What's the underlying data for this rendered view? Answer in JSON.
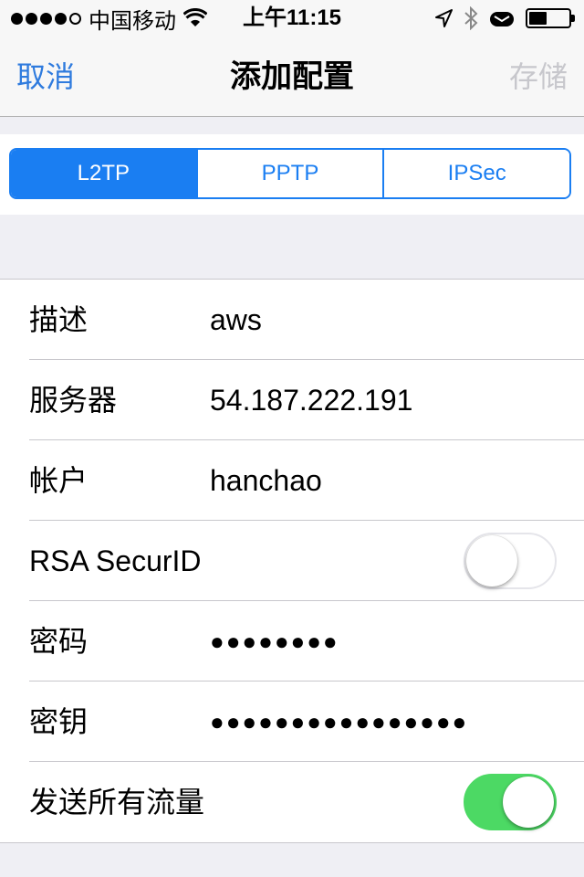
{
  "status_bar": {
    "carrier": "中国移动",
    "time": "上午11:15"
  },
  "nav": {
    "cancel_label": "取消",
    "title": "添加配置",
    "save_label": "存储"
  },
  "segments": [
    {
      "label": "L2TP",
      "selected": true
    },
    {
      "label": "PPTP",
      "selected": false
    },
    {
      "label": "IPSec",
      "selected": false
    }
  ],
  "form": {
    "description": {
      "label": "描述",
      "value": "aws"
    },
    "server": {
      "label": "服务器",
      "value": "54.187.222.191"
    },
    "account": {
      "label": "帐户",
      "value": "hanchao"
    },
    "rsa_securid": {
      "label": "RSA SecurID",
      "on": false
    },
    "password": {
      "label": "密码",
      "value": "●●●●●●●●"
    },
    "secret": {
      "label": "密钥",
      "value": "●●●●●●●●●●●●●●●●"
    },
    "send_all_traffic": {
      "label": "发送所有流量",
      "on": true
    }
  },
  "colors": {
    "accent": "#1a7ef2",
    "toggle_on": "#4cd964"
  },
  "icons": [
    "signal-strength-icon",
    "wifi-icon",
    "location-arrow-icon",
    "bluetooth-icon",
    "mail-icon",
    "battery-icon"
  ],
  "battery_level": 0.45
}
